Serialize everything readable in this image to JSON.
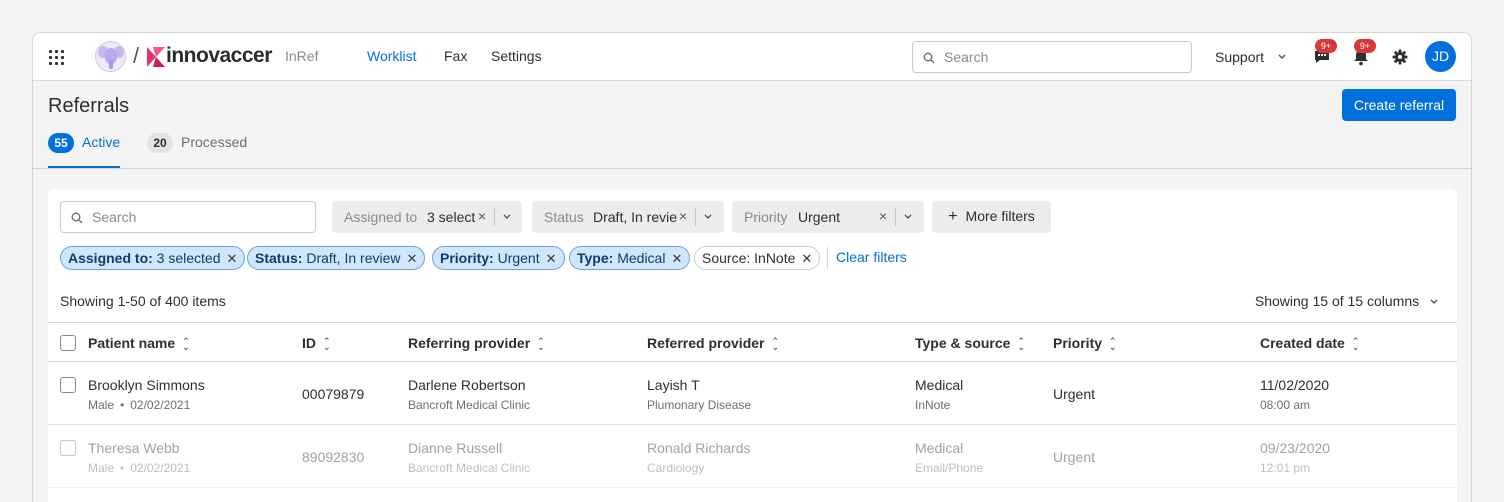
{
  "header": {
    "brand": "innovaccer",
    "product": "InRef",
    "nav": [
      {
        "label": "Worklist",
        "active": true
      },
      {
        "label": "Fax",
        "active": false
      },
      {
        "label": "Settings",
        "active": false
      }
    ],
    "search_placeholder": "Search",
    "support_label": "Support",
    "messages_badge": "9+",
    "notifications_badge": "9+",
    "avatar_initials": "JD",
    "accent_color": "#0070dd"
  },
  "page": {
    "title": "Referrals",
    "create_label": "Create referral",
    "tabs": [
      {
        "count": "55",
        "label": "Active",
        "active": true
      },
      {
        "count": "20",
        "label": "Processed",
        "active": false
      }
    ]
  },
  "filters": {
    "search_placeholder": "Search",
    "dropdowns": [
      {
        "label": "Assigned to",
        "value": "3 select"
      },
      {
        "label": "Status",
        "value": "Draft, In revie"
      },
      {
        "label": "Priority",
        "value": "Urgent"
      }
    ],
    "more_label": "More filters",
    "chips": [
      {
        "key": "Assigned to:",
        "value": "3 selected",
        "selected": true
      },
      {
        "key": "Status:",
        "value": "Draft, In review",
        "selected": true
      },
      {
        "key": "Priority:",
        "value": "Urgent",
        "selected": true
      },
      {
        "key": "Type:",
        "value": "Medical",
        "selected": true
      },
      {
        "key": "Source:",
        "value": "InNote",
        "selected": false
      }
    ],
    "clear_label": "Clear filters"
  },
  "table": {
    "showing_text": "Showing 1-50 of 400 items",
    "columns_text": "Showing 15 of 15 columns",
    "headers": [
      "Patient name",
      "ID",
      "Referring provider",
      "Referred provider",
      "Type & source",
      "Priority",
      "Created date"
    ],
    "rows": [
      {
        "name": "Brooklyn Simmons",
        "gender": "Male",
        "dob": "02/02/2021",
        "id": "00079879",
        "referring": "Darlene Robertson",
        "referring_org": "Bancroft Medical Clinic",
        "referred": "Layish T",
        "referred_specialty": "Plumonary Disease",
        "type": "Medical",
        "source": "InNote",
        "priority": "Urgent",
        "date": "11/02/2020",
        "time": "08:00 am"
      },
      {
        "name": "Theresa Webb",
        "gender": "Male",
        "dob": "02/02/2021",
        "id": "89092830",
        "referring": "Dianne Russell",
        "referring_org": "Bancroft Medical Clinic",
        "referred": "Ronald Richards",
        "referred_specialty": "Cardiology",
        "type": "Medical",
        "source": "Email/Phone",
        "priority": "Urgent",
        "date": "09/23/2020",
        "time": "12:01 pm"
      }
    ]
  }
}
